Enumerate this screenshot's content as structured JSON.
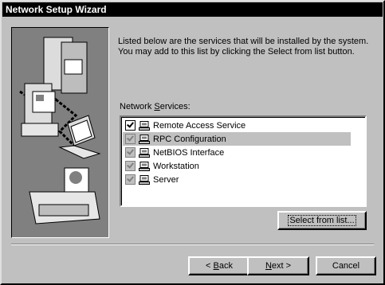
{
  "window": {
    "title": "Network Setup Wizard"
  },
  "description": [
    "Listed below are the services that will be installed by the system.",
    "You may add to this list by clicking the Select from list button."
  ],
  "services_label": {
    "pre": "Network ",
    "key": "S",
    "post": "ervices:"
  },
  "services": [
    {
      "label": "Remote Access Service",
      "checked": true,
      "enabled": true,
      "selected": false
    },
    {
      "label": "RPC Configuration",
      "checked": true,
      "enabled": false,
      "selected": true
    },
    {
      "label": "NetBIOS Interface",
      "checked": true,
      "enabled": false,
      "selected": false
    },
    {
      "label": "Workstation",
      "checked": true,
      "enabled": false,
      "selected": false
    },
    {
      "label": "Server",
      "checked": true,
      "enabled": false,
      "selected": false
    }
  ],
  "buttons": {
    "select": "Select from list...",
    "back_key": "B",
    "back_rest": "ack",
    "next_key": "N",
    "next_rest": "ext",
    "cancel": "Cancel"
  },
  "icons": {
    "service": "network-computer-icon",
    "illustration": "network-computers-illustration"
  },
  "colors": {
    "face": "#c0c0c0",
    "title": "#000000",
    "art": "#808080"
  }
}
